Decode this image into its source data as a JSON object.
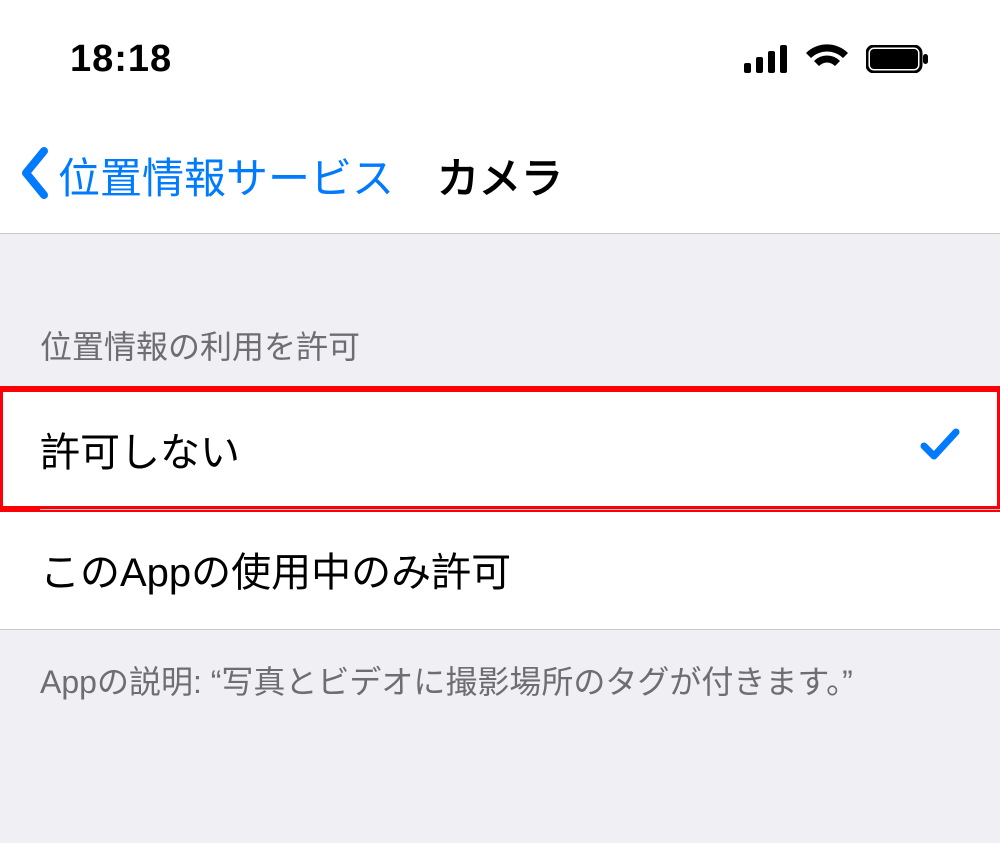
{
  "status": {
    "time": "18:18"
  },
  "nav": {
    "back_label": "位置情報サービス",
    "title": "カメラ"
  },
  "section_header": "位置情報の利用を許可",
  "options": [
    {
      "label": "許可しない",
      "selected": true,
      "highlighted": true
    },
    {
      "label": "このAppの使用中のみ許可",
      "selected": false,
      "highlighted": false
    }
  ],
  "footer": "Appの説明: “写真とビデオに撮影場所のタグが付きます。”",
  "colors": {
    "tint": "#007aff",
    "highlight": "#fb0007"
  }
}
